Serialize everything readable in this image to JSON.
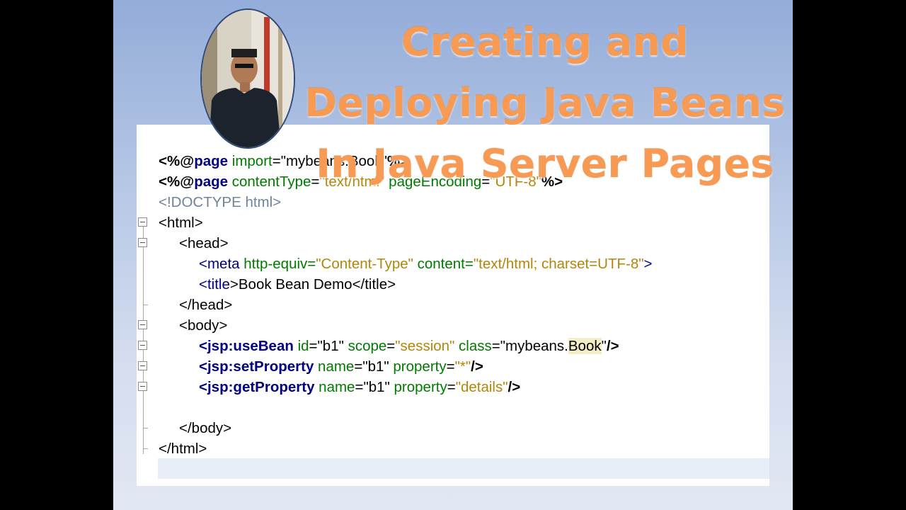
{
  "slide": {
    "title_lines": [
      "Creating and",
      "Deploying Java Beans",
      "In Java Server Pages"
    ],
    "photo_desc": "presenter-photo"
  },
  "code": {
    "l1": {
      "a": "<%@",
      "b": "page",
      "c": " import",
      "d": "=",
      "e": "\"mybeans.Book\"",
      "f": "%>"
    },
    "l2": {
      "a": "<%@",
      "b": "page",
      "c": " contentType",
      "d": "=",
      "e": "\"text/html\"",
      "f": " pageEncoding",
      "g": "=",
      "h": "\"UTF-8\"",
      "i": "%>"
    },
    "l3": "<!DOCTYPE html>",
    "l4": "<html>",
    "l5": "<head>",
    "l6": {
      "a": "<",
      "b": "meta",
      "c": " http-equiv",
      "d": "=",
      "e": "\"Content-Type\"",
      "f": " content",
      "g": "=",
      "h": "\"text/html; charset=UTF-8\"",
      "i": ">"
    },
    "l7": {
      "a": "<",
      "b": "title",
      "c": ">",
      "d": "Book Bean Demo",
      "e": "</title>"
    },
    "l8": "</head>",
    "l9": "<body>",
    "l10": {
      "a": "<jsp:useBean",
      "b": " id",
      "c": "=",
      "d": "\"b1\"",
      "e": " scope",
      "f": "=",
      "g": "\"session\"",
      "h": " class",
      "i": "=",
      "j": "\"mybeans.",
      "k": "Book",
      "l": "\"",
      "m": "/>"
    },
    "l11": {
      "a": "<jsp:setProperty",
      "b": " name",
      "c": "=",
      "d": "\"b1\"",
      "e": " property",
      "f": "=",
      "g": "\"*\"",
      "h": "/>"
    },
    "l12": {
      "a": "<jsp:getProperty",
      "b": " name",
      "c": "=",
      "d": "\"b1\"",
      "e": " property",
      "f": "=",
      "g": "\"details\"",
      "h": "/>"
    },
    "l13": "</body>",
    "l14": "</html>"
  }
}
